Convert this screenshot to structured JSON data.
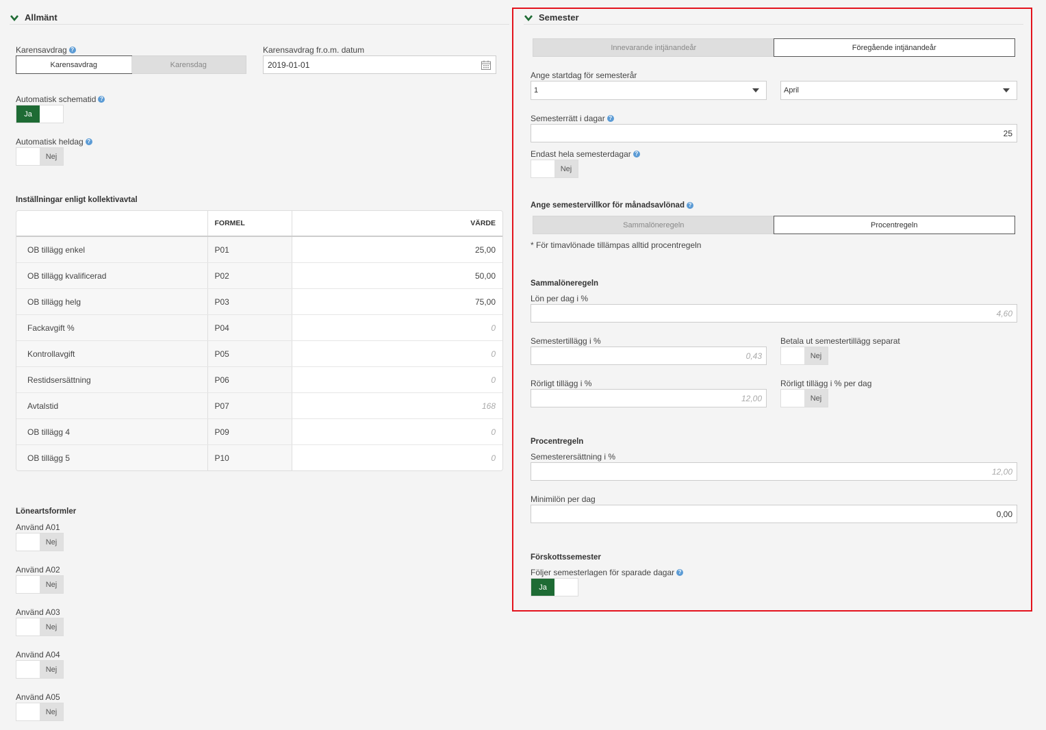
{
  "allmant": {
    "title": "Allmänt",
    "karensavdrag_label": "Karensavdrag",
    "karensavdrag_options": [
      "Karensavdrag",
      "Karensdag"
    ],
    "karens_date_label": "Karensavdrag fr.o.m. datum",
    "karens_date_value": "2019-01-01",
    "auto_schematid_label": "Automatisk schematid",
    "auto_schematid_value": "Ja",
    "auto_heldag_label": "Automatisk heldag",
    "auto_heldag_value": "Nej",
    "kollektiv_title": "Inställningar enligt kollektivavtal",
    "table": {
      "headers": [
        "",
        "FORMEL",
        "VÄRDE"
      ],
      "rows": [
        {
          "name": "OB tillägg enkel",
          "formel": "P01",
          "value": "25,00",
          "placeholder": false
        },
        {
          "name": "OB tillägg kvalificerad",
          "formel": "P02",
          "value": "50,00",
          "placeholder": false
        },
        {
          "name": "OB tillägg helg",
          "formel": "P03",
          "value": "75,00",
          "placeholder": false
        },
        {
          "name": "Fackavgift %",
          "formel": "P04",
          "value": "0",
          "placeholder": true
        },
        {
          "name": "Kontrollavgift",
          "formel": "P05",
          "value": "0",
          "placeholder": true
        },
        {
          "name": "Restidsersättning",
          "formel": "P06",
          "value": "0",
          "placeholder": true
        },
        {
          "name": "Avtalstid",
          "formel": "P07",
          "value": "168",
          "placeholder": true
        },
        {
          "name": "OB tillägg 4",
          "formel": "P09",
          "value": "0",
          "placeholder": true
        },
        {
          "name": "OB tillägg 5",
          "formel": "P10",
          "value": "0",
          "placeholder": true
        }
      ]
    },
    "loneart_title": "Löneartsformler",
    "loneart_items": [
      {
        "label": "Använd A01",
        "value": "Nej"
      },
      {
        "label": "Använd A02",
        "value": "Nej"
      },
      {
        "label": "Använd A03",
        "value": "Nej"
      },
      {
        "label": "Använd A04",
        "value": "Nej"
      },
      {
        "label": "Använd A05",
        "value": "Nej"
      }
    ]
  },
  "semester": {
    "title": "Semester",
    "tabs": [
      "Innevarande intjänandeår",
      "Föregående intjänandeår"
    ],
    "startdag_label": "Ange startdag för semesterår",
    "startdag_day": "1",
    "startdag_month": "April",
    "ratt_label": "Semesterrätt i dagar",
    "ratt_value": "25",
    "hela_label": "Endast hela semesterdagar",
    "hela_value": "Nej",
    "villkor_label": "Ange semestervillkor för månadsavlönad",
    "villkor_options": [
      "Sammalöneregeln",
      "Procentregeln"
    ],
    "villkor_note": "* För timavlönade tillämpas alltid procentregeln",
    "sammal_title": "Sammalöneregeln",
    "lon_per_dag_label": "Lön per dag i %",
    "lon_per_dag_value": "4,60",
    "tillagg_label": "Semestertillägg i %",
    "tillagg_value": "0,43",
    "betala_label": "Betala ut semestertillägg separat",
    "betala_value": "Nej",
    "rorligt_label": "Rörligt tillägg i %",
    "rorligt_value": "12,00",
    "rorligt_dag_label": "Rörligt tillägg i % per dag",
    "rorligt_dag_value": "Nej",
    "procent_title": "Procentregeln",
    "ersattning_label": "Semesterersättning i %",
    "ersattning_value": "12,00",
    "minimilon_label": "Minimilön per dag",
    "minimilon_value": "0,00",
    "forskott_title": "Förskottssemester",
    "foljer_label": "Följer semesterlagen för sparade dagar",
    "foljer_value": "Ja"
  },
  "colors": {
    "accent_green": "#1e6b34",
    "highlight_red": "#e3121c",
    "help_blue": "#5b9bd5"
  }
}
